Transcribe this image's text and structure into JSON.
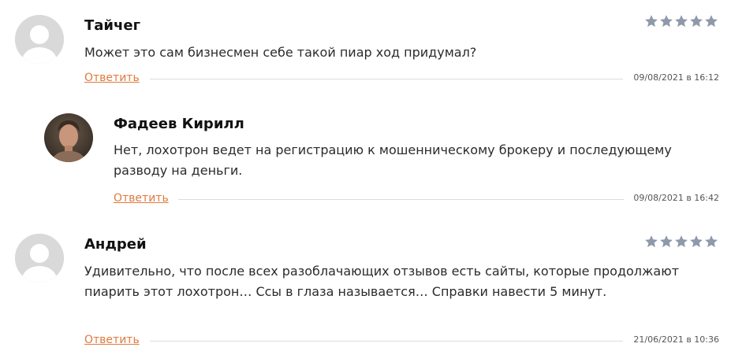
{
  "comments": [
    {
      "author": "Тайчег",
      "text": "Может это сам бизнесмен себе такой пиар ход придумал?",
      "reply": "Ответить",
      "date": "09/08/2021 в 16:12",
      "rating": 5,
      "avatar": "default-avatar"
    },
    {
      "author": "Фадеев Кирилл",
      "text": "Нет, лохотрон ведет на регистрацию к мошенническому брокеру и последующему разводу на деньги.",
      "reply": "Ответить",
      "date": "09/08/2021 в 16:42",
      "avatar": "photo-avatar"
    },
    {
      "author": "Андрей",
      "text": "Удивительно, что после всех разоблачающих отзывов есть сайты, которые продолжают пиарить этот лохотрон… Ссы в глаза называется… Справки навести 5 минут.",
      "reply": "Ответить",
      "date": "21/06/2021 в 10:36",
      "rating": 5,
      "avatar": "default-avatar"
    }
  ],
  "colors": {
    "reply_link": "#e07a3c",
    "star": "#8e9aaa",
    "divider": "#dcdcdc",
    "avatar_bg": "#d9d9d9"
  }
}
